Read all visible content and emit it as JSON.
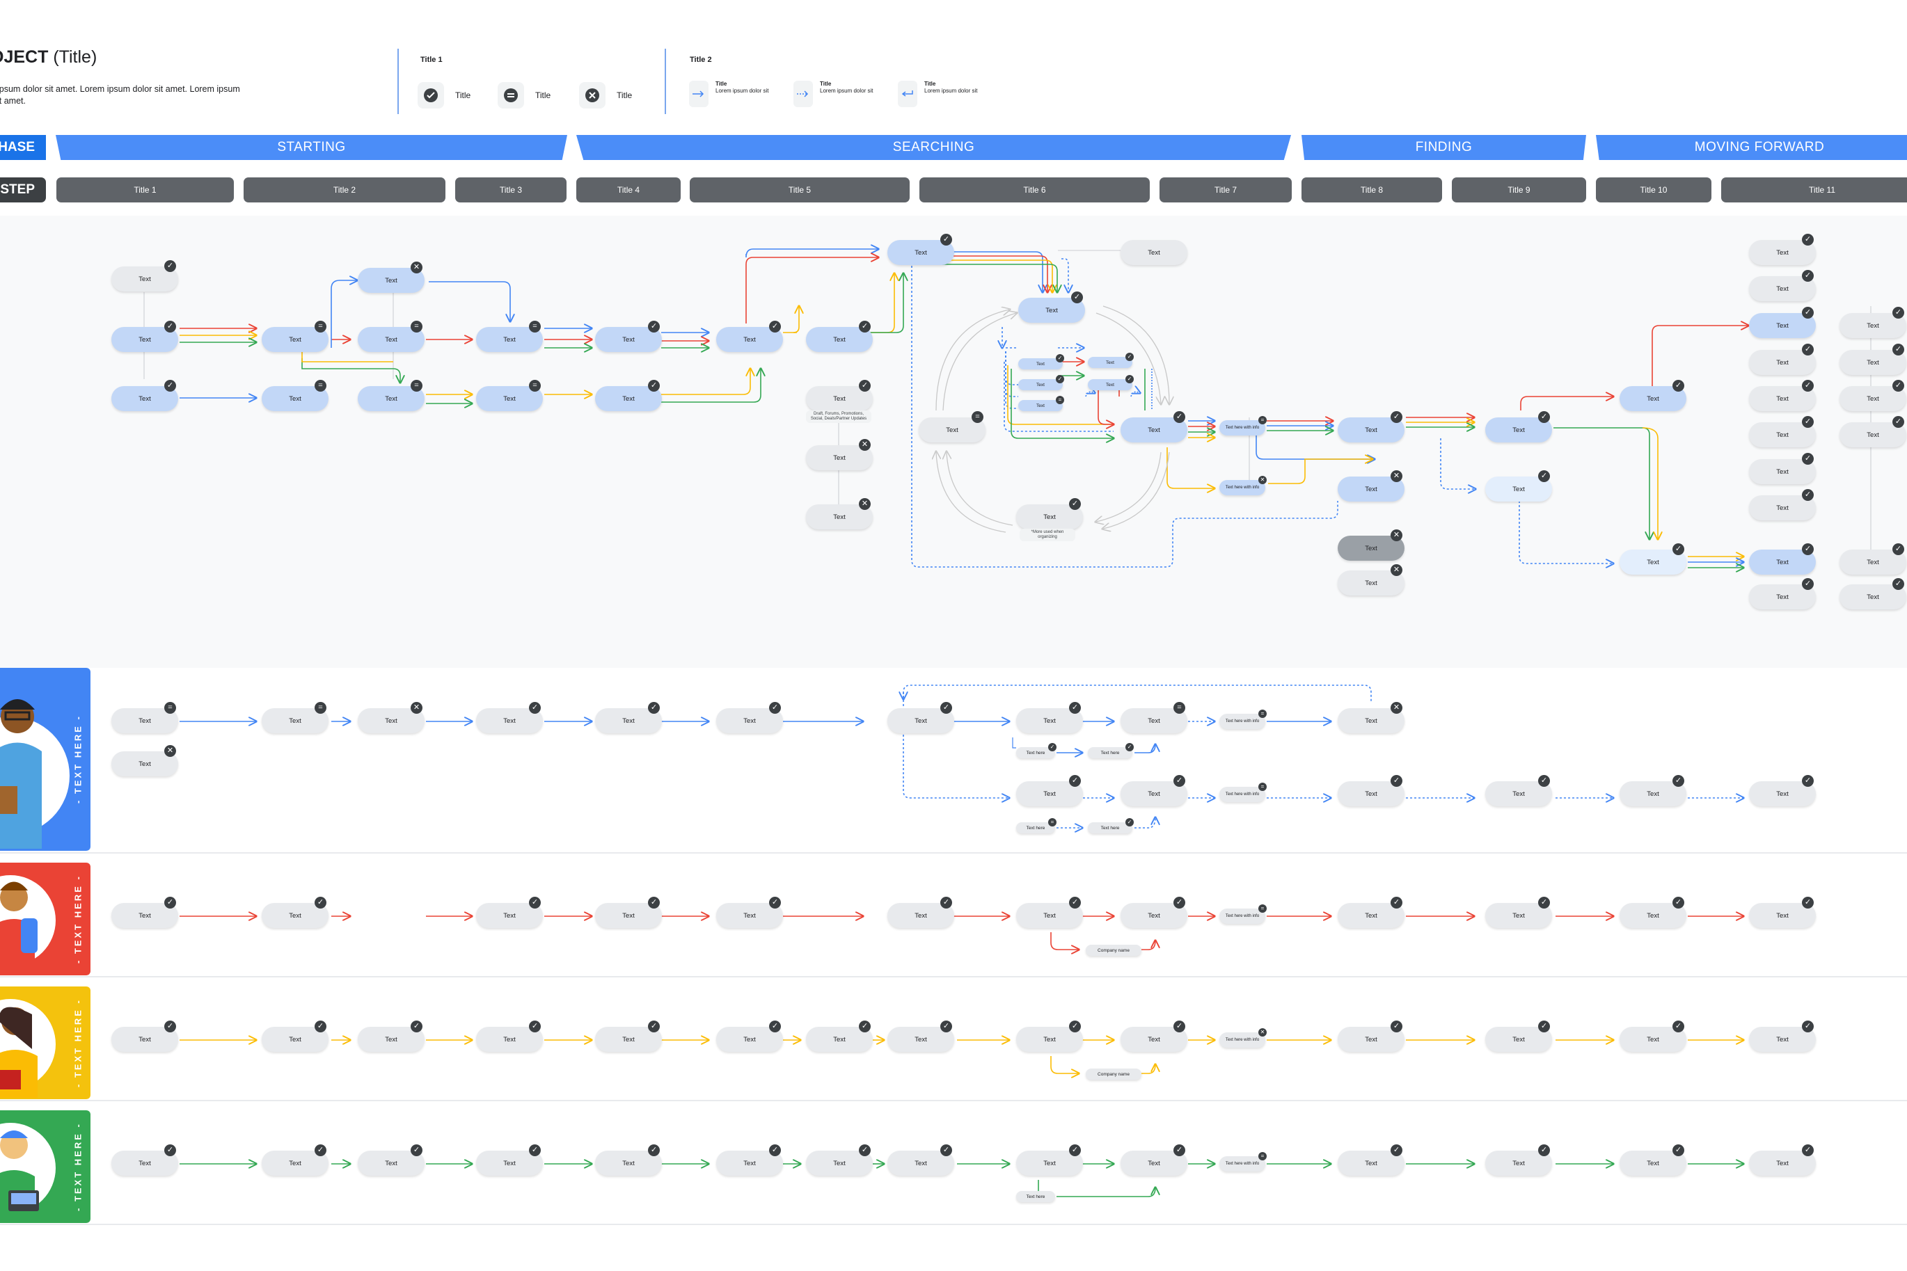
{
  "header": {
    "title_bold": "OJECT",
    "title_rest": "(Title)",
    "description": "ipsum dolor sit amet. Lorem ipsum dolor sit amet. Lorem ipsum\nit amet."
  },
  "legend1": {
    "title": "Title 1",
    "items": [
      {
        "label": "Title",
        "icon": "check-icon"
      },
      {
        "label": "Title",
        "icon": "minus-icon"
      },
      {
        "label": "Title",
        "icon": "x-icon"
      }
    ]
  },
  "legend2": {
    "title": "Title 2",
    "items": [
      {
        "title": "Title",
        "desc": "Lorem ipsum dolor sit",
        "icon": "solid-arrow-icon"
      },
      {
        "title": "Title",
        "desc": "Lorem ipsum dolor sit",
        "icon": "dotted-arrow-icon"
      },
      {
        "title": "Title",
        "desc": "Lorem ipsum dolor sit",
        "icon": "return-arrow-icon"
      }
    ]
  },
  "phase_label": "HASE",
  "step_label": "STEP",
  "phases": [
    "STARTING",
    "SEARCHING",
    "FINDING",
    "MOVING FORWARD"
  ],
  "steps": [
    "Title 1",
    "Title 2",
    "Title 3",
    "Title 4",
    "Title 5",
    "Title 6",
    "Title 7",
    "Title 8",
    "Title 9",
    "Title 10",
    "Title 11"
  ],
  "node_text": "Text",
  "text_here": "Text here",
  "text_here_info": "Text here with info",
  "company_name": "Company name",
  "notes": {
    "grey_note": "Draft, Forums, Promotions, Social, Deals/Partner Updates",
    "more_used": "*More used when organizing"
  },
  "personas": [
    {
      "label": "- TEXT HERE -",
      "color": "#4285f4"
    },
    {
      "label": "- TEXT HERE -",
      "color": "#ea4335"
    },
    {
      "label": "- TEXT HERE -",
      "color": "#f4c20d"
    },
    {
      "label": "- TEXT HERE -",
      "color": "#34a853"
    }
  ],
  "colors": {
    "blue": "#4285f4",
    "red": "#ea4335",
    "yellow": "#fbbc04",
    "green": "#34a853"
  }
}
